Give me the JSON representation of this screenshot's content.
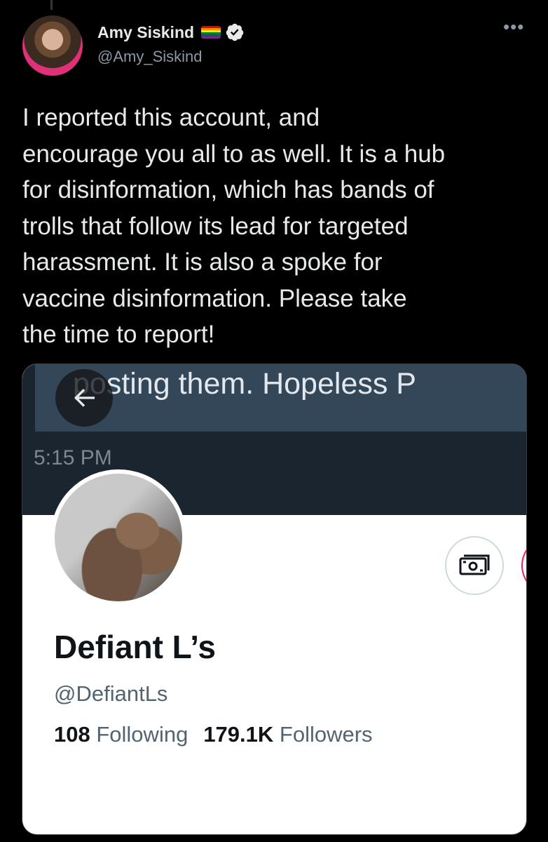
{
  "tweet": {
    "author_name": "Amy Siskind",
    "author_handle": "@Amy_Siskind",
    "more_icon": "more-horizontal-icon",
    "text": "I reported this account, and\nencourage you all to as well. It is a hub\nfor disinformation, which has bands of\ntrolls that follow its lead for targeted\nharassment. It is also a spoke for\nvaccine disinformation. Please take\nthe time to report!"
  },
  "embedded_profile": {
    "banner_text": "posting them. Hopeless P",
    "banner_time": "5:15 PM",
    "name": "Defiant L’s",
    "handle": "@DefiantLs",
    "following_count": "108",
    "following_label": "Following",
    "followers_count": "179.1K",
    "followers_label": "Followers",
    "tip_icon": "money-icon",
    "back_icon": "arrow-left-icon"
  },
  "colors": {
    "background": "#000000",
    "text": "#e7e9ea",
    "secondary_text": "#8b98a5",
    "card_background": "#ffffff",
    "banner": "#334759"
  }
}
